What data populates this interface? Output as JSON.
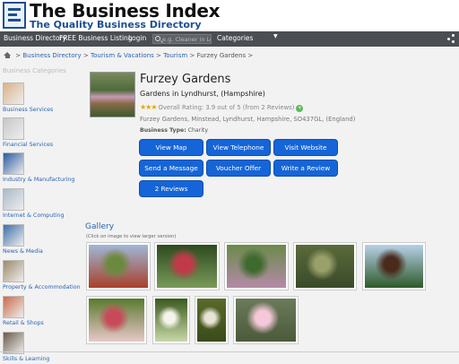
{
  "site": {
    "title": "The Business Index",
    "tagline": "The Quality Business Directory"
  },
  "nav": {
    "items": [
      "Business Directory",
      "FREE Business Listing",
      "Login"
    ],
    "search_placeholder": "e.g. Cleaner in Lo",
    "categories_label": "Categories",
    "caret": "▼"
  },
  "breadcrumb": {
    "links": [
      "Business Directory",
      "Tourism & Vacations",
      "Tourism"
    ],
    "current": "Furzey Gardens",
    "sep": ">",
    "prefix": ">",
    "suffix": ">"
  },
  "sidebar": {
    "heading": "Business Categories",
    "items": [
      {
        "label": "Business Services",
        "color": "#d9b28a"
      },
      {
        "label": "Financial Services",
        "color": "#c7c7c7"
      },
      {
        "label": "Industry & Manufacturing",
        "color": "#2c5aa0"
      },
      {
        "label": "Internet & Computing",
        "color": "#a9b9c9"
      },
      {
        "label": "News & Media",
        "color": "#3f6fa8"
      },
      {
        "label": "Property & Accommodation",
        "color": "#9a8b6a"
      },
      {
        "label": "Retail & Shops",
        "color": "#c86a4a"
      },
      {
        "label": "Skills & Learning",
        "color": "#6b5a4a"
      }
    ]
  },
  "business": {
    "name": "Furzey Gardens",
    "location": "Gardens in Lyndhurst, (Hampshire)",
    "stars": "★★★",
    "rating_text": "Overall Rating: 3.9 out of 5 (from 2 Reviews)",
    "rating_plus": "+",
    "address": "Furzey Gardens, Minstead, Lyndhurst, Hampshire, SO437GL, (England)",
    "type_label": "Business Type:",
    "type_value": "Charity",
    "buttons": [
      "View Map",
      "View Telephone",
      "Visit Website",
      "Send a Message",
      "Voucher Offer",
      "Write a Review",
      "2 Reviews"
    ]
  },
  "gallery": {
    "title": "Gallery",
    "hint": "(Click on image to view larger version)",
    "images": [
      {
        "colors": [
          "#9fb7d6",
          "#6b8a3e",
          "#a8402a"
        ]
      },
      {
        "colors": [
          "#2d4a1e",
          "#c23a4a",
          "#7a9a5a"
        ]
      },
      {
        "colors": [
          "#6a8a4a",
          "#3e6a2e",
          "#b58aa8"
        ]
      },
      {
        "colors": [
          "#5a6a3a",
          "#9aa06a",
          "#3a4a2a"
        ]
      },
      {
        "colors": [
          "#b8d0e8",
          "#4a2a1a",
          "#2e5a2a"
        ]
      },
      {
        "colors": [
          "#5a7a2e",
          "#c84a5a",
          "#e8c8c8"
        ]
      },
      {
        "colors": [
          "#3a5a1e",
          "#f4f4ea",
          "#c8d8a8"
        ]
      },
      {
        "colors": [
          "#5a6a2a",
          "#e8e4d4",
          "#3a4a1a"
        ]
      },
      {
        "colors": [
          "#6a7a5a",
          "#f4c8d8",
          "#4a5a3a"
        ]
      }
    ]
  }
}
